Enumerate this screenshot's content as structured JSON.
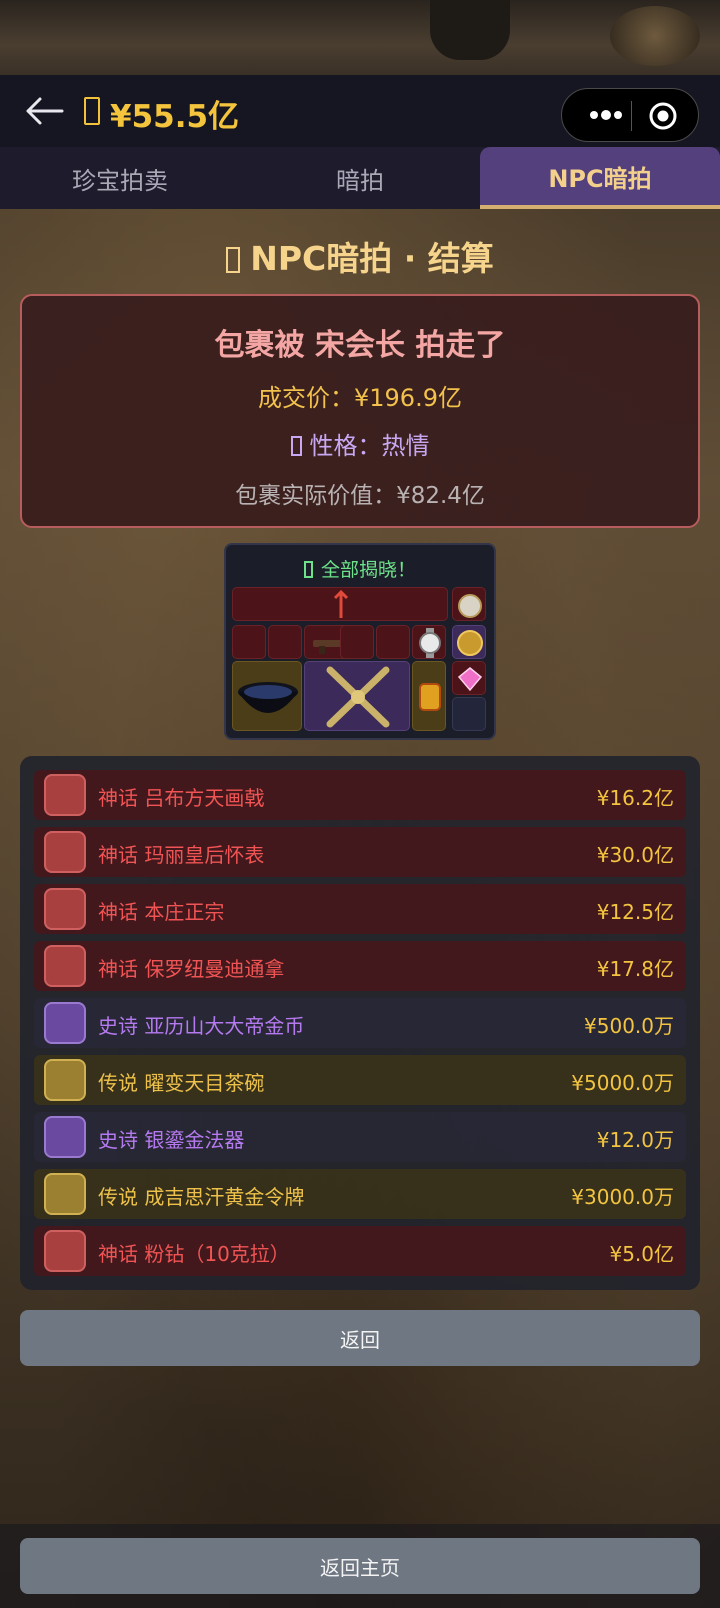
{
  "navbar": {
    "balance": "¥55.5亿"
  },
  "tabs": [
    {
      "label": "珍宝拍卖",
      "active": false
    },
    {
      "label": "暗拍",
      "active": false
    },
    {
      "label": "NPC暗拍",
      "active": true
    }
  ],
  "heading": "NPC暗拍 · 结算",
  "result": {
    "winner_text": "包裹被 宋会长 拍走了",
    "deal_price": "成交价：¥196.9亿",
    "personality": "性格：热情",
    "actual_value": "包裹实际价值：¥82.4亿"
  },
  "grid": {
    "reveal_text": "全部揭晓！"
  },
  "items": [
    {
      "rarity": "mythic",
      "name": "神话 吕布方天画戟",
      "price": "¥16.2亿",
      "icon": "halberd-icon"
    },
    {
      "rarity": "mythic",
      "name": "神话 玛丽皇后怀表",
      "price": "¥30.0亿",
      "icon": "pocket-watch-icon"
    },
    {
      "rarity": "mythic",
      "name": "神话 本庄正宗",
      "price": "¥12.5亿",
      "icon": "katana-icon"
    },
    {
      "rarity": "mythic",
      "name": "神话 保罗纽曼迪通拿",
      "price": "¥17.8亿",
      "icon": "wristwatch-icon"
    },
    {
      "rarity": "epic",
      "name": "史诗 亚历山大大帝金币",
      "price": "¥500.0万",
      "icon": "gold-coin-icon"
    },
    {
      "rarity": "legend",
      "name": "传说 曜变天目茶碗",
      "price": "¥5000.0万",
      "icon": "tea-bowl-icon"
    },
    {
      "rarity": "epic",
      "name": "史诗 银鎏金法器",
      "price": "¥12.0万",
      "icon": "vajra-icon"
    },
    {
      "rarity": "legend",
      "name": "传说 成吉思汗黄金令牌",
      "price": "¥3000.0万",
      "icon": "gold-tablet-icon"
    },
    {
      "rarity": "mythic",
      "name": "神话 粉钻（10克拉）",
      "price": "¥5.0亿",
      "icon": "pink-diamond-icon"
    }
  ],
  "buttons": {
    "back": "返回",
    "home": "返回主页"
  },
  "colors": {
    "accent_gold": "#f3c43c",
    "mythic": "#f05454",
    "epic": "#b57af0",
    "legend": "#eec24a",
    "tab_active": "#54407c"
  }
}
